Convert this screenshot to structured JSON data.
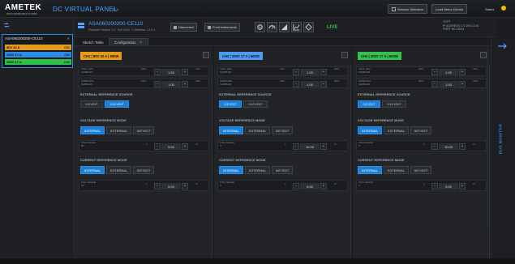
{
  "header": {
    "logo": "AMETEK",
    "logo_sub": "PROGRAMMABLE POWER",
    "title": "DC VIRTUAL PANEL",
    "version": "V1.0",
    "btn_session": "Session Selection",
    "btn_load_device": "Load Demo Device",
    "status_label": "Status",
    "status_color": "#f0c000"
  },
  "left_panel": {
    "device_name": "ASA060200200-CE110",
    "close_glyph": "✕",
    "channels": [
      {
        "label": "80V  42 A",
        "tag": "CH1",
        "color": "#e59a1a"
      },
      {
        "label": "200V  17 A",
        "tag": "CH2",
        "color": "#2e8be6"
      },
      {
        "label": "200V  17 A",
        "tag": "CH3",
        "color": "#2ec04a"
      }
    ]
  },
  "device_header": {
    "title": "ASA060200200-CE110",
    "info": "Firmware Version 1.0 · S/N 1234 · 1 Address: 1.2.3.4",
    "btn_reset": "Disconnect",
    "btn_more": "Front Instruments",
    "live": "LIVE",
    "right_info_1": "TOTP",
    "right_info_2": "IP ADDRESS 172.294.12.40",
    "right_info_3": "PORT NO 10001",
    "accent": "#4da3ff"
  },
  "tabs": [
    {
      "label": "Sketch Table",
      "active": false
    },
    {
      "label": "Configuration",
      "active": true
    }
  ],
  "channels": [
    {
      "badge": "CH1 | 80V 42 A | 600W",
      "badge_color": "#e59a1a",
      "volt_label_1": "VOLT. AVG",
      "volt_label_2": "SAMPLES",
      "volt_value": "1.00",
      "volt_mini_l": "INFO",
      "volt_mini_r": "INFO",
      "curr_label_1": "CURR AVG",
      "curr_label_2": "SAMPLES",
      "curr_value": "1.00",
      "ext_ref_title": "EXTERNAL REFERENCE SOURCE",
      "ext_opts": [
        "0-5 VOLT",
        "0-10 VOLT"
      ],
      "ext_sel": 1,
      "vref_title": "VOLTAGE REFERENCE MODE",
      "vref_opts": [
        "INTERNAL",
        "EXTERNAL",
        "INT+EXT"
      ],
      "vref_sel": 0,
      "vfs_label_1": "FULL SCALE",
      "vfs_label_2": "80",
      "vfs_value": "5.00",
      "vfs_min": "0",
      "vfs_max": "10",
      "cref_title": "CURRENT REFERENCE MODE",
      "cref_opts": [
        "INTERNAL",
        "EXTERNAL",
        "INT+EXT"
      ],
      "cref_sel": 0,
      "cfs_label_1": "FULL SCALE",
      "cfs_label_2": "42",
      "cfs_value": "5.00",
      "cfs_min": "0",
      "cfs_max": "10"
    },
    {
      "badge": "CH2 | 200V 17 A | 600W",
      "badge_color": "#4d9bf0",
      "volt_label_1": "VOLT. AVG",
      "volt_label_2": "SAMPLES",
      "volt_value": "1.00",
      "volt_mini_l": "INFO",
      "volt_mini_r": "INFO",
      "curr_label_1": "CURR AVG",
      "curr_label_2": "SAMPLES",
      "curr_value": "1.00",
      "ext_ref_title": "EXTERNAL REFERENCE SOURCE",
      "ext_opts": [
        "0-5 VOLT",
        "0-10 VOLT"
      ],
      "ext_sel": 0,
      "vref_title": "VOLTAGE REFERENCE MODE",
      "vref_opts": [
        "INTERNAL",
        "EXTERNAL",
        "INT+EXT"
      ],
      "vref_sel": 0,
      "vfs_label_1": "FULL SCALE",
      "vfs_label_2": "V",
      "vfs_value": "10.00",
      "vfs_min": "0",
      "vfs_max": "10",
      "cref_title": "CURRENT REFERENCE MODE",
      "cref_opts": [
        "INTERNAL",
        "EXTERNAL",
        "INT+EXT"
      ],
      "cref_sel": 0,
      "cfs_label_1": "FULL SCALE",
      "cfs_label_2": "V",
      "cfs_value": "5.00",
      "cfs_min": "0",
      "cfs_max": "10"
    },
    {
      "badge": "CH3 | 200V 17 A | 600W",
      "badge_color": "#35c04f",
      "volt_label_1": "VOLT. AVG",
      "volt_label_2": "SAMPLES",
      "volt_value": "1.00",
      "volt_mini_l": "INFO",
      "volt_mini_r": "INFO",
      "curr_label_1": "CURR AVG",
      "curr_label_2": "SAMPLES",
      "curr_value": "1.00",
      "ext_ref_title": "EXTERNAL REFERENCE SOURCE",
      "ext_opts": [
        "0-5 VOLT",
        "0-10 VOLT"
      ],
      "ext_sel": 0,
      "vref_title": "VOLTAGE REFERENCE MODE",
      "vref_opts": [
        "INTERNAL",
        "EXTERNAL",
        "INT+EXT"
      ],
      "vref_sel": 0,
      "vfs_label_1": "FULL SCALE",
      "vfs_label_2": "V",
      "vfs_value": "10.00",
      "vfs_min": "0",
      "vfs_max": "10",
      "cref_title": "CURRENT REFERENCE MODE",
      "cref_opts": [
        "INTERNAL",
        "EXTERNAL",
        "INT+EXT"
      ],
      "cref_sel": 0,
      "cfs_label_1": "FULL SCALE",
      "cfs_label_2": "V",
      "cfs_value": "5.00",
      "cfs_min": "0",
      "cfs_max": "10"
    }
  ],
  "right_rail": {
    "bus_monitor": "BUS MONITOR"
  }
}
